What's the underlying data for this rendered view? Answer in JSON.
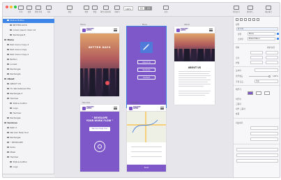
{
  "toolbar": {
    "buttons": [
      "추가",
      "심볼",
      "연결 목록",
      "복사",
      "편집",
      "변환",
      "변형",
      "화면 분할하기",
      "데이터",
      "끝"
    ],
    "zoom": "100%",
    "right_labels": [
      "보기",
      "미리보기",
      "클라우드",
      "내보내기"
    ],
    "segments": [
      "편집",
      "검색"
    ]
  },
  "layers": {
    "rows": [
      {
        "label": "Status Button",
        "level": 1,
        "selected": true,
        "group": false
      },
      {
        "label": "BETTER DAYS",
        "level": 2,
        "selected": false,
        "group": false
      },
      {
        "label": "Lorem ipsum dolor sit",
        "level": 2,
        "selected": false,
        "group": false
      },
      {
        "label": "Rectangle 8",
        "level": 2,
        "selected": false,
        "group": false
      },
      {
        "label": "Menu",
        "level": 0,
        "selected": false,
        "group": true
      },
      {
        "label": "Red menu Copy 4",
        "level": 1,
        "selected": false,
        "group": false
      },
      {
        "label": "Red menu Copy",
        "level": 1,
        "selected": false,
        "group": false
      },
      {
        "label": "Red menu Copy 2",
        "level": 1,
        "selected": false,
        "group": false
      },
      {
        "label": "Button",
        "level": 1,
        "selected": false,
        "group": false
      },
      {
        "label": "Locket",
        "level": 1,
        "selected": false,
        "group": false
      },
      {
        "label": "Rectangle",
        "level": 1,
        "selected": false,
        "group": false
      },
      {
        "label": "Rectangle",
        "level": 1,
        "selected": false,
        "group": false
      },
      {
        "label": "About",
        "level": 0,
        "selected": false,
        "group": true
      },
      {
        "label": "ABOUT US",
        "level": 1,
        "selected": false,
        "group": false
      },
      {
        "label": "Hi, We believed tha",
        "level": 1,
        "selected": false,
        "group": false
      },
      {
        "label": "Rectangle 3",
        "level": 1,
        "selected": false,
        "group": false
      },
      {
        "label": "Hed bar",
        "level": 1,
        "selected": false,
        "group": false
      },
      {
        "label": "Status button",
        "level": 2,
        "selected": false,
        "group": false
      },
      {
        "label": "Logo",
        "level": 2,
        "selected": false,
        "group": false
      },
      {
        "label": "Hed bar",
        "level": 2,
        "selected": false,
        "group": false
      },
      {
        "label": "Rectangle",
        "level": 1,
        "selected": false,
        "group": false
      },
      {
        "label": "Services",
        "level": 0,
        "selected": false,
        "group": true
      },
      {
        "label": "Path 3",
        "level": 1,
        "selected": false,
        "group": false
      },
      {
        "label": "We Can Help You!",
        "level": 1,
        "selected": false,
        "group": false
      },
      {
        "label": "Rectangle",
        "level": 1,
        "selected": false,
        "group": false
      },
      {
        "label": "\" DEVELOPE",
        "level": 1,
        "selected": false,
        "group": false
      },
      {
        "label": "Suits",
        "level": 1,
        "selected": false,
        "group": false
      },
      {
        "label": "Mask",
        "level": 1,
        "selected": false,
        "group": false
      },
      {
        "label": "Hed bar",
        "level": 1,
        "selected": false,
        "group": false
      },
      {
        "label": "Status button",
        "level": 2,
        "selected": false,
        "group": false
      },
      {
        "label": "Logo",
        "level": 2,
        "selected": false,
        "group": false
      }
    ]
  },
  "artboards": {
    "home": {
      "label": "Home",
      "logo": "ROCKET\nAPPS",
      "title": "BETTER DAYS"
    },
    "menu": {
      "label": "Menu",
      "buttons": [
        "About Us",
        "Services",
        "Contact"
      ]
    },
    "about": {
      "label": "About",
      "logo": "ROCKET\nAPPS",
      "heading": "ABOUT US"
    },
    "services": {
      "label": "Services",
      "logo": "ROCKET\nAPPS",
      "quote": "\" DEVELOPE\nYOUR WORK FLOW \"",
      "button": "We Can Help You!"
    },
    "contact": {
      "label": "Contact",
      "logo": "ROCKET\nAPPS",
      "button": "Send"
    }
  },
  "inspector": {
    "header_left": "정렬",
    "header_right": "화면 분할",
    "field1": "어 1 어",
    "label_font": "글꼴",
    "font_value": "Menu",
    "label_style": "스타일",
    "style_value": "Bread Menu",
    "section_pos": "위치",
    "section_size": "크기",
    "section_transform": "변형",
    "label_corner": "모서리",
    "label_opacity": "불투명도",
    "label_blend": "혼합 모드",
    "label_fill": "채우기",
    "label_border": "테두리",
    "label_shadow": "그림자",
    "label_inner": "내부 그림자",
    "label_blur": "흐림",
    "section_export": "내보내기",
    "value_blend": "보통",
    "value_opacity": "100%"
  },
  "colors": {
    "accent": "#3d86e8",
    "brand_purple": "#7e57c9"
  }
}
